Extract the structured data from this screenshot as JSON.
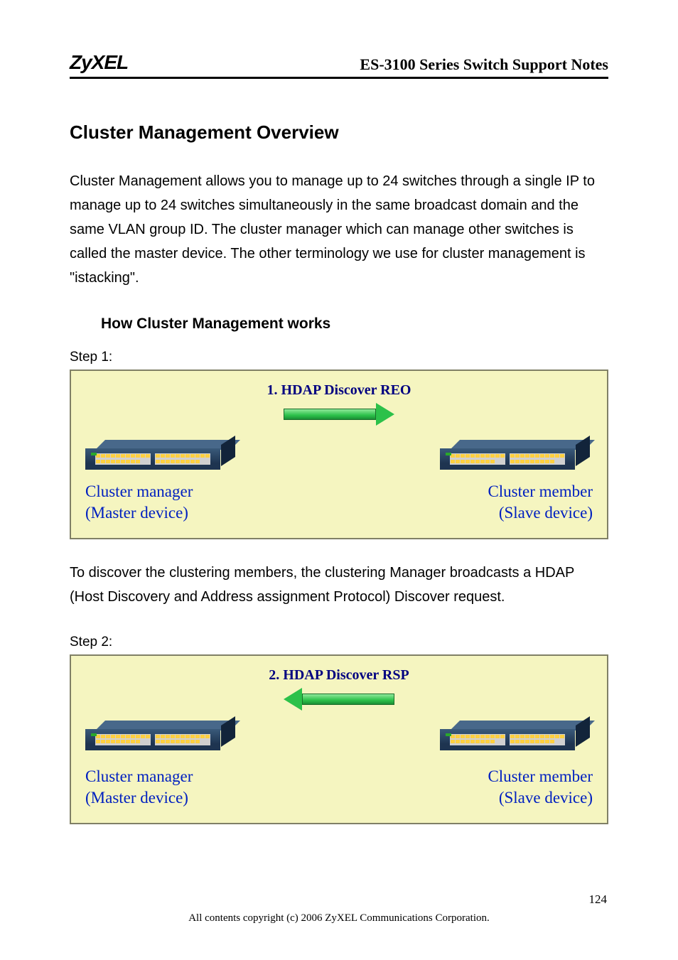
{
  "header": {
    "logo": "ZyXEL",
    "title": "ES-3100 Series Switch Support Notes"
  },
  "section_title": "Cluster Management Overview",
  "intro_para": "Cluster Management allows you to manage up to 24 switches through a single IP to manage up to 24 switches simultaneously in the same broadcast domain and the same VLAN group ID. The cluster manager which can manage other switches is called the master device. The other terminology we use for cluster management is \"istacking\".",
  "sub_title": "How Cluster Management works",
  "step1_label": "Step 1:",
  "diagram1": {
    "title": "1. HDAP  Discover  REO",
    "left_label_1": "Cluster manager",
    "left_label_2": "(Master device)",
    "right_label_1": "Cluster member",
    "right_label_2": "(Slave device)"
  },
  "para2": "To discover the clustering members, the clustering Manager broadcasts a HDAP (Host Discovery and Address assignment Protocol) Discover request.",
  "step2_label": "Step 2:",
  "diagram2": {
    "title": "2. HDAP Discover RSP",
    "left_label_1": "Cluster manager",
    "left_label_2": "(Master device)",
    "right_label_1": "Cluster member",
    "right_label_2": "(Slave device)"
  },
  "footer": {
    "page": "124",
    "copyright": "All contents copyright (c) 2006 ZyXEL Communications Corporation."
  }
}
